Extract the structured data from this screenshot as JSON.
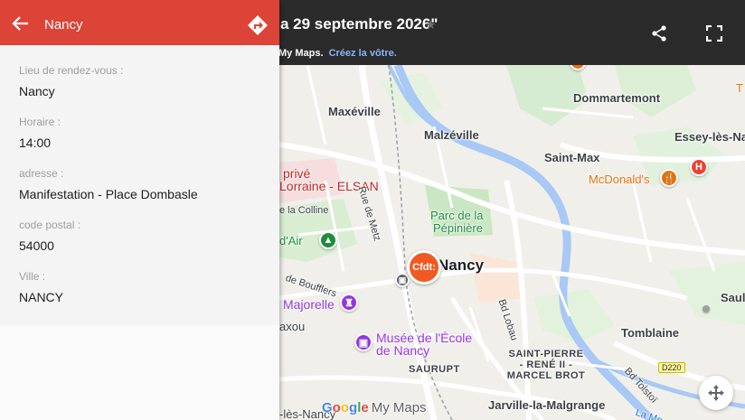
{
  "header": {
    "title_fragment": "a 29 septembre 2026\"",
    "subtitle_prefix": "My Maps.",
    "subtitle_link": "Créez la vôtre."
  },
  "panel": {
    "title": "Nancy",
    "fields": [
      {
        "key": "Lieu de rendez-vous :",
        "value": "Nancy"
      },
      {
        "key": "Horaire :",
        "value": "14:00"
      },
      {
        "key": "adresse :",
        "value": "Manifestation - Place Dombasle"
      },
      {
        "key": "code postal :",
        "value": "54000"
      },
      {
        "key": "Ville :",
        "value": "NANCY"
      }
    ]
  },
  "map": {
    "labels": {
      "dommartemont": "Dommartemont",
      "maxeville": "Maxéville",
      "malzeville": "Malzéville",
      "saint_max": "Saint-Max",
      "essey": "Essey-lès-Nan",
      "mcdonalds": "McDonald's",
      "prive": "privé",
      "lorraine_elsan": "Lorraine - ELSAN",
      "rue_de_metz": "Rue de Metz",
      "de_la_colline": "e la Colline",
      "parc_line1": "Parc de la",
      "parc_line2": "Pépinière",
      "dair": "d'Air",
      "nancy": "Nancy",
      "boufflers": "de Boufflers",
      "majorelle": "Majorelle",
      "bd_lobau": "Bd Lobau",
      "saul": "Saul",
      "axou": "axou",
      "musee_line1": "Musée de l'École",
      "musee_line2": "de Nancy",
      "tomblaine": "Tomblaine",
      "saint_pierre_1": "SAINT-PIERRE",
      "saint_pierre_2": "- RENÉ II -",
      "saint_pierre_3": "MARCEL BROT",
      "saurupt": "SAURUPT",
      "d220": "D220",
      "bd_tolstoi": "Bd Tolstoï",
      "jarville": "Jarville-la-Malgrange",
      "les_nancy": "-lès-Nancy",
      "la_me": "La Me",
      "cfdt": "Cfdt:"
    },
    "logo": {
      "g": "G",
      "o1": "o",
      "o2": "o",
      "g2": "g",
      "l": "l",
      "e": "e",
      "my_maps": "My Maps"
    }
  },
  "colors": {
    "panel_header": "#db4437",
    "top_bar": "#2b2b2b",
    "cfdt_pin": "#f05a22",
    "link": "#8ab4f8"
  }
}
